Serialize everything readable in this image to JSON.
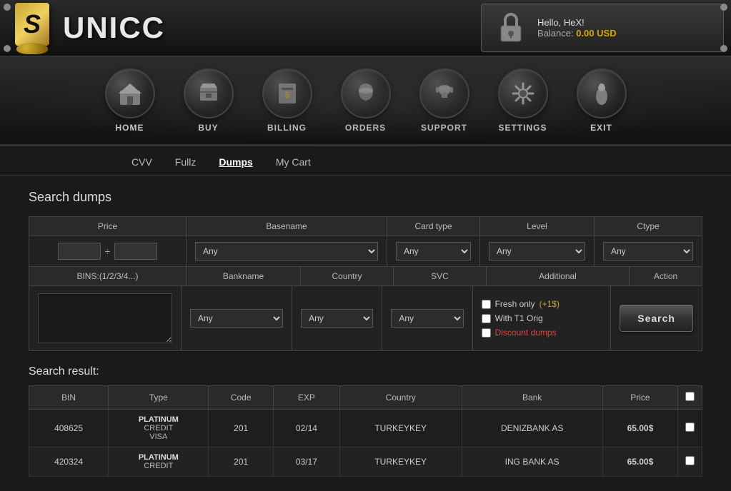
{
  "logo": {
    "s_letter": "S",
    "brand_name": "UNICC"
  },
  "header": {
    "greeting": "Hello, HeX!",
    "balance_label": "Balance:",
    "balance_value": "0.00 USD"
  },
  "nav": {
    "items": [
      {
        "id": "home",
        "label": "HOME",
        "icon": "house"
      },
      {
        "id": "buy",
        "label": "BUY",
        "icon": "wallet"
      },
      {
        "id": "billing",
        "label": "BILLING",
        "icon": "dollar-sign"
      },
      {
        "id": "orders",
        "label": "ORDERS",
        "icon": "bag"
      },
      {
        "id": "support",
        "label": "SUPPORT",
        "icon": "phone"
      },
      {
        "id": "settings",
        "label": "SETTINGS",
        "icon": "gear"
      },
      {
        "id": "exit",
        "label": "EXIT",
        "icon": "bullet"
      }
    ]
  },
  "submenu": {
    "items": [
      {
        "id": "cvv",
        "label": "CVV",
        "active": false
      },
      {
        "id": "fullz",
        "label": "Fullz",
        "active": false
      },
      {
        "id": "dumps",
        "label": "Dumps",
        "active": true
      },
      {
        "id": "mycart",
        "label": "My Cart",
        "active": false
      }
    ]
  },
  "search": {
    "title": "Search dumps",
    "price_label": "Price",
    "basename_label": "Basename",
    "cardtype_label": "Card type",
    "level_label": "Level",
    "ctype_label": "Ctype",
    "bins_label": "BINS:",
    "bins_hint": "(1/2/3/4...)",
    "bankname_label": "Bankname",
    "country_label": "Country",
    "svc_label": "SVC",
    "additional_label": "Additional",
    "action_label": "Action",
    "price_min": "",
    "price_max": "",
    "any_option": "Any",
    "checkboxes": {
      "fresh_only": "Fresh only",
      "fresh_plus": "(+1$)",
      "with_t1": "With T1 Orig",
      "discount": "Discount dumps"
    },
    "search_button": "Search"
  },
  "results": {
    "title": "Search result:",
    "columns": [
      "BIN",
      "Type",
      "Code",
      "EXP",
      "Country",
      "Bank",
      "Price",
      ""
    ],
    "rows": [
      {
        "bin": "408625",
        "type_line1": "PLATINUM",
        "type_line2": "CREDIT",
        "type_line3": "VISA",
        "code": "201",
        "exp": "02/14",
        "country": "TURKEYKEY",
        "bank": "DENIZBANK AS",
        "price": "65.00$",
        "checked": false
      },
      {
        "bin": "420324",
        "type_line1": "PLATINUM",
        "type_line2": "CREDIT",
        "type_line3": "",
        "code": "201",
        "exp": "03/17",
        "country": "TURKEYKEY",
        "bank": "ING BANK AS",
        "price": "65.00$",
        "checked": false
      }
    ]
  }
}
